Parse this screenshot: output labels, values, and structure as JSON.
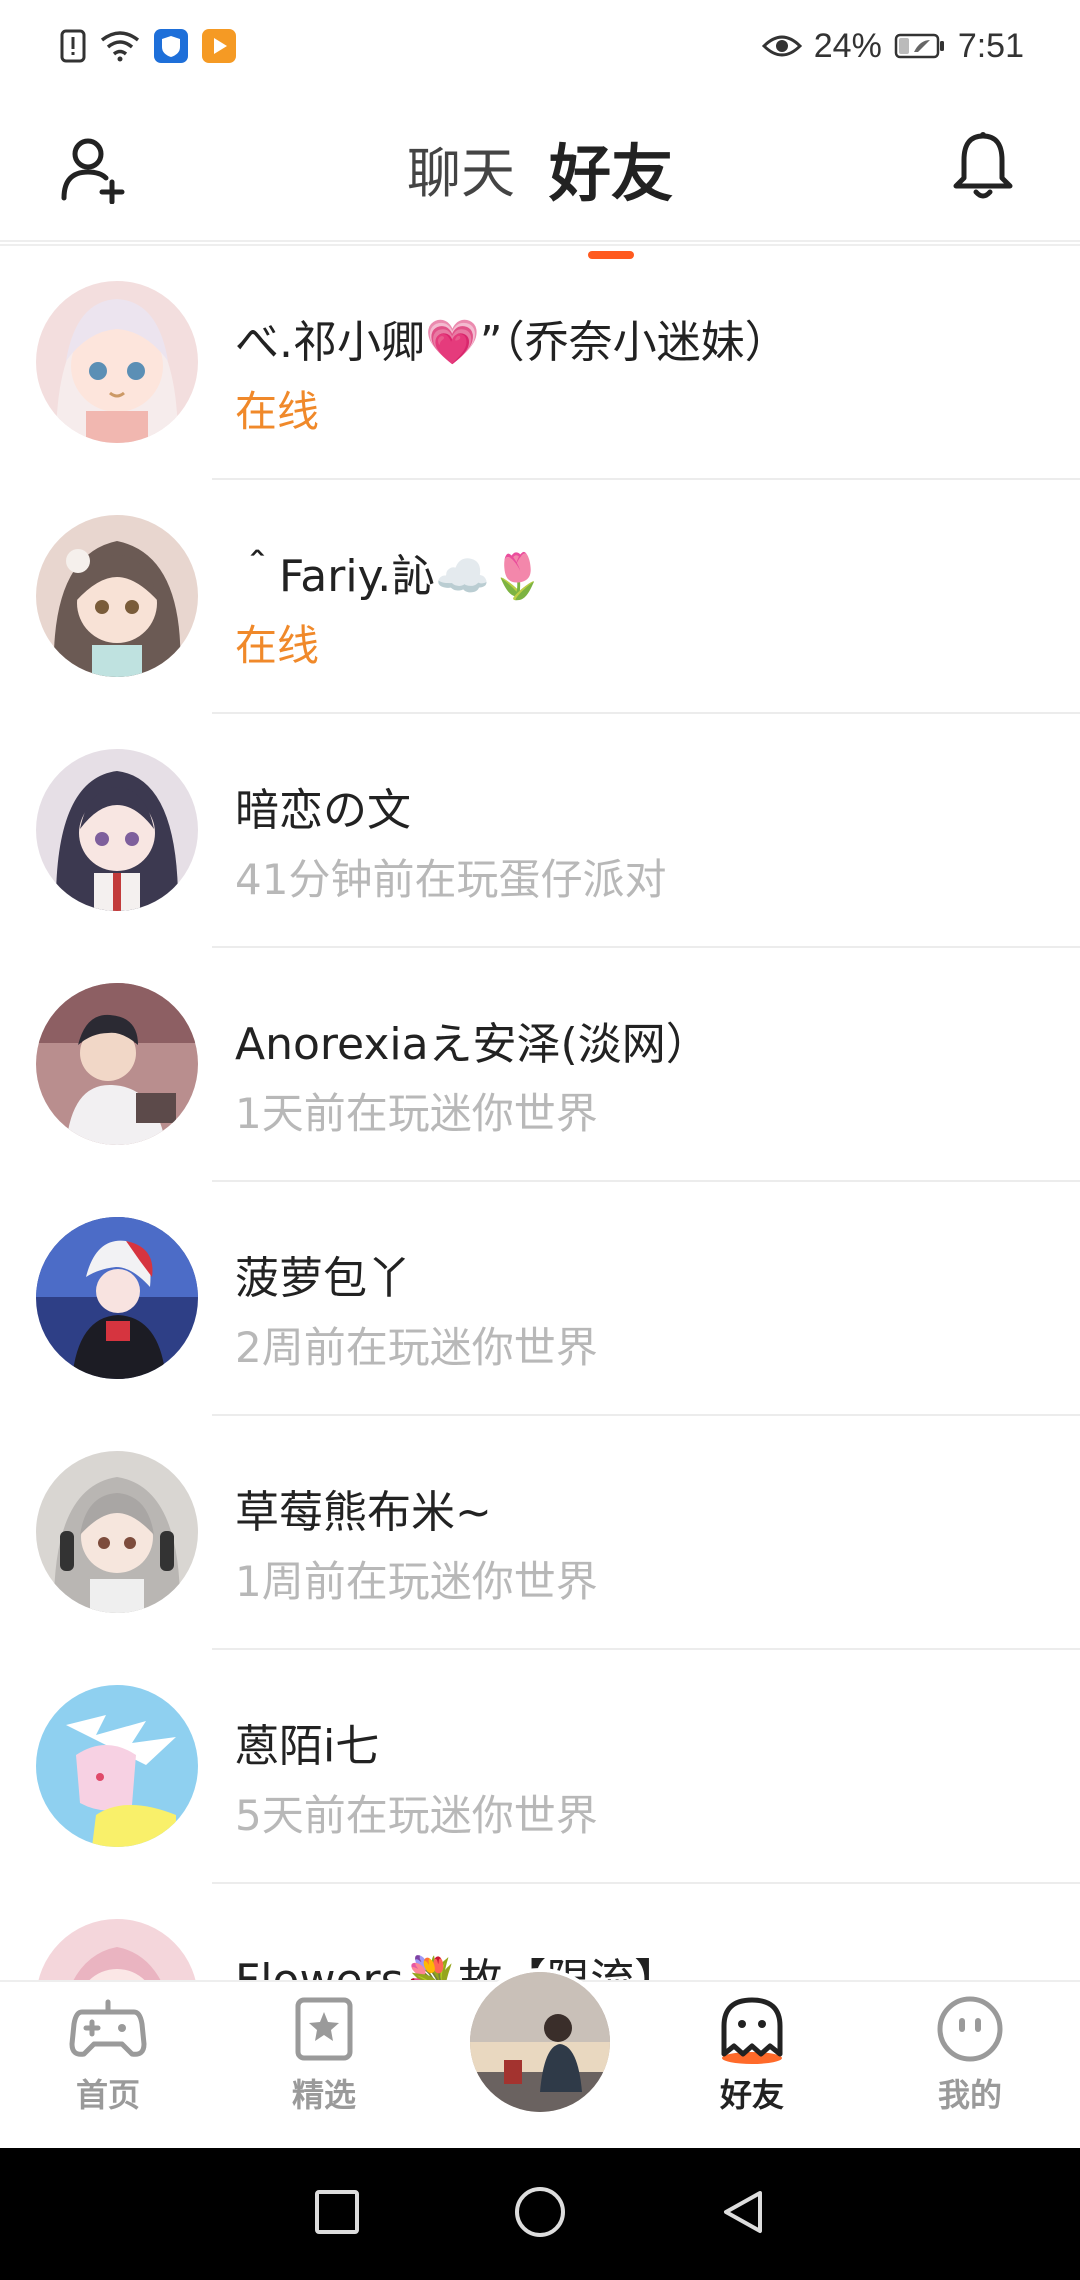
{
  "status_bar": {
    "battery": "24%",
    "time": "7:51",
    "icons": [
      "alert-icon",
      "wifi-icon",
      "shield-app-icon",
      "play-app-icon",
      "eye-icon",
      "battery-icon"
    ]
  },
  "header": {
    "tabs": [
      {
        "label": "聊天",
        "active": false
      },
      {
        "label": "好友",
        "active": true
      }
    ],
    "left_icon": "add-friend-icon",
    "right_icon": "bell-icon",
    "accent_color": "#ff5a1f"
  },
  "friends": [
    {
      "name": "べ.祁小卿💗”（乔奈小迷妹）",
      "status": "在线",
      "online": true
    },
    {
      "name": "＾Fariy.訫☁️🌷",
      "status": "在线",
      "online": true
    },
    {
      "name": "暗恋の文",
      "status": "41分钟前在玩蛋仔派对",
      "online": false
    },
    {
      "name": "Anorexiaえ安泽(淡网）",
      "status": "1天前在玩迷你世界",
      "online": false
    },
    {
      "name": "菠萝包丫",
      "status": "2周前在玩迷你世界",
      "online": false
    },
    {
      "name": "草莓熊布米~",
      "status": "1周前在玩迷你世界",
      "online": false
    },
    {
      "name": "蒽陌i七",
      "status": "5天前在玩迷你世界",
      "online": false
    },
    {
      "name": "Flowers💐故【限流】",
      "status": "",
      "online": false
    }
  ],
  "bottom_tabs": [
    {
      "label": "首页",
      "icon": "gamepad-icon",
      "active": false
    },
    {
      "label": "精选",
      "icon": "star-card-icon",
      "active": false
    },
    {
      "label": "好友",
      "icon": "ghost-icon",
      "active": true
    },
    {
      "label": "我的",
      "icon": "face-icon",
      "active": false
    }
  ],
  "colors": {
    "online": "#f0892a",
    "muted": "#b8b8b8",
    "accent": "#ff5a1f"
  }
}
